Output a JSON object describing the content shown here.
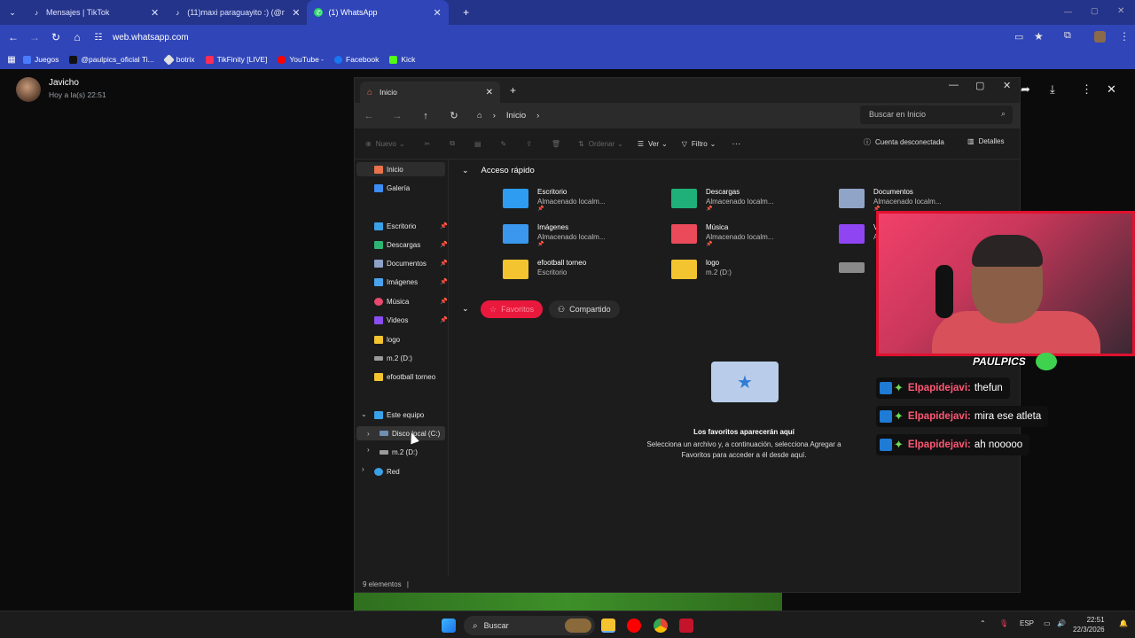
{
  "browser": {
    "tabs": [
      {
        "label": "Mensajes | TikTok",
        "favicon": "tiktok-icon"
      },
      {
        "label": "(11)maxi paraguayito :) (@maxi",
        "favicon": "tiktok-icon"
      },
      {
        "label": "(1) WhatsApp",
        "favicon": "whatsapp-icon"
      }
    ],
    "url": "web.whatsapp.com",
    "bookmarks": [
      {
        "label": "Juegos",
        "color": "#4a7cff"
      },
      {
        "label": "@paulpics_oficial Ti...",
        "color": "#111111"
      },
      {
        "label": "botrix",
        "color": "#e0e0e0"
      },
      {
        "label": "TikFinity [LIVE]",
        "color": "#ff2d55"
      },
      {
        "label": "YouTube -",
        "color": "#ff0000"
      },
      {
        "label": "Facebook",
        "color": "#1877f2"
      },
      {
        "label": "Kick",
        "color": "#53fc18"
      }
    ]
  },
  "whatsapp": {
    "contact_name": "Javicho",
    "contact_time": "Hoy a la(s) 22:51"
  },
  "explorer": {
    "tab_title": "Inicio",
    "breadcrumb": "Inicio",
    "search_placeholder": "Buscar en Inicio",
    "commands": {
      "new": "Nuevo",
      "sort": "Ordenar",
      "view": "Ver",
      "filter": "Filtro",
      "more": "···",
      "account": "Cuenta desconectada",
      "details": "Detalles"
    },
    "sidebar": {
      "top": [
        {
          "label": "Inicio",
          "color": "#e8734a"
        },
        {
          "label": "Galería",
          "color": "#3d8df5"
        }
      ],
      "pinned": [
        {
          "label": "Escritorio",
          "color": "#3aa0e8"
        },
        {
          "label": "Descargas",
          "color": "#2fb573"
        },
        {
          "label": "Documentos",
          "color": "#8ea1c8"
        },
        {
          "label": "Imágenes",
          "color": "#4aa3ef"
        },
        {
          "label": "Música",
          "color": "#e9496e"
        },
        {
          "label": "Videos",
          "color": "#8a4df0"
        }
      ],
      "folders": [
        {
          "label": "logo",
          "color": "#f4c430"
        },
        {
          "label": "m.2 (D:)",
          "color": "#9a9a9a"
        },
        {
          "label": "efootball torneo",
          "color": "#f4c430"
        }
      ],
      "this_pc": "Este equipo",
      "drives": [
        "Disco local (C:)",
        "m.2 (D:)"
      ],
      "network": "Red"
    },
    "quick_access_title": "Acceso rápido",
    "quick_access": [
      {
        "name": "Escritorio",
        "sub": "Almacenado localm...",
        "color": "#2e9cf0"
      },
      {
        "name": "Descargas",
        "sub": "Almacenado localm...",
        "color": "#1fb07a"
      },
      {
        "name": "Documentos",
        "sub": "Almacenado localm...",
        "color": "#90a4c8"
      },
      {
        "name": "Imágenes",
        "sub": "Almacenado localm...",
        "color": "#3b97ee"
      },
      {
        "name": "Música",
        "sub": "Almacenado localm...",
        "color": "#ea4a5a"
      },
      {
        "name": "V",
        "sub": "A",
        "color": "#8f46f2"
      },
      {
        "name": "efootball torneo",
        "sub": "Escritorio",
        "color": "#f4c430"
      },
      {
        "name": "logo",
        "sub": "m.2 (D:)",
        "color": "#f4c430"
      },
      {
        "name": "",
        "sub": "",
        "color": "#8a8a8a"
      }
    ],
    "pills": {
      "favorites": "Favoritos",
      "shared": "Compartido"
    },
    "empty_title": "Los favoritos aparecerán aquí",
    "empty_line1": "Selecciona un archivo y, a continuación, selecciona Agregar a",
    "empty_line2": "Favoritos para acceder a él desde aquí.",
    "status": "9 elementos"
  },
  "stream": {
    "brand": "PAULPICS",
    "chat": [
      {
        "user": "Elpapidejavi:",
        "msg": "thefun"
      },
      {
        "user": "Elpapidejavi:",
        "msg": "mira ese atleta"
      },
      {
        "user": "Elpapidejavi:",
        "msg": "ah nooooo"
      }
    ]
  },
  "taskbar": {
    "search": "Buscar",
    "lang": "ESP",
    "time": "22:51",
    "date": "22/3/2026"
  }
}
